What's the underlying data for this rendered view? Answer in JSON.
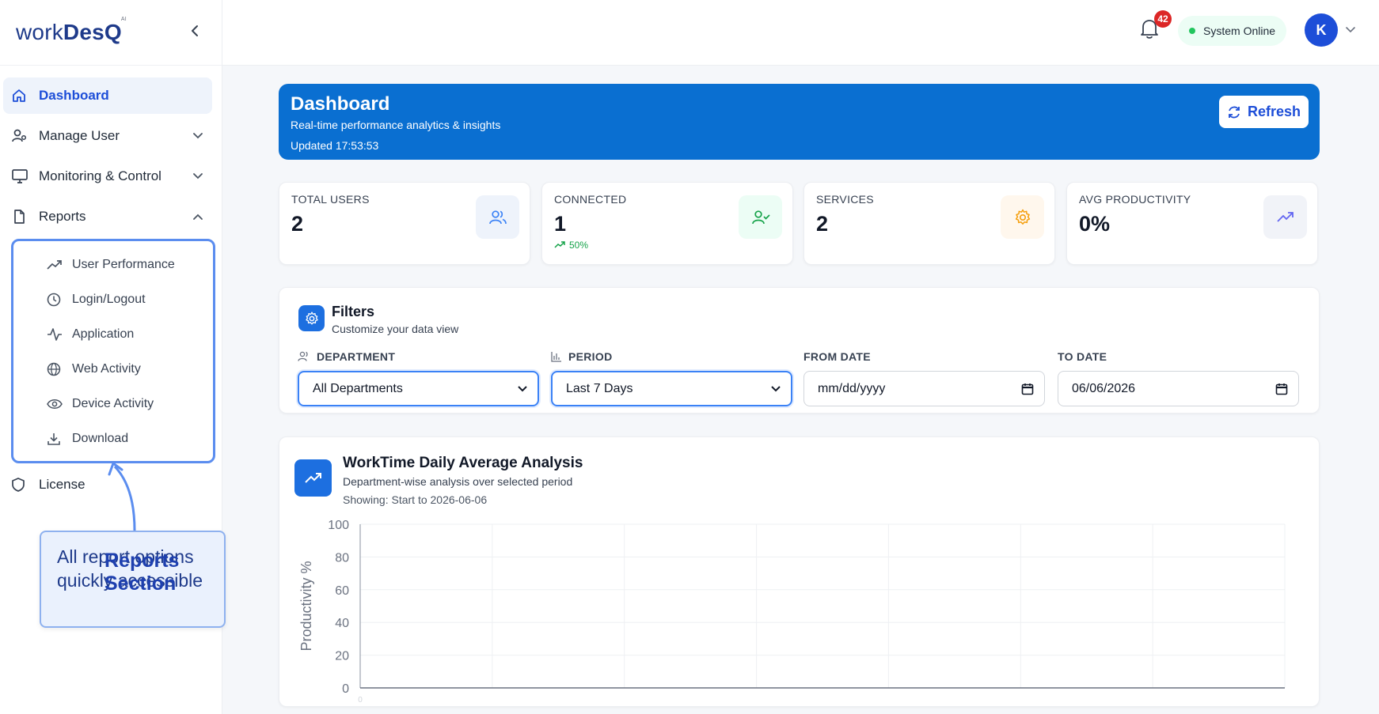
{
  "brand": {
    "part1": "work",
    "part2": "DesQ",
    "mark": "AI"
  },
  "sidebar": {
    "items": [
      {
        "label": "Dashboard",
        "icon": "home-icon"
      },
      {
        "label": "Manage User",
        "icon": "users-icon"
      },
      {
        "label": "Monitoring & Control",
        "icon": "monitor-icon"
      },
      {
        "label": "Reports",
        "icon": "file-icon"
      },
      {
        "label": "License",
        "icon": "shield-icon"
      }
    ],
    "reports_sub": [
      {
        "label": "User Performance",
        "icon": "trending-up-icon"
      },
      {
        "label": "Login/Logout",
        "icon": "clock-icon"
      },
      {
        "label": "Application",
        "icon": "activity-icon"
      },
      {
        "label": "Web Activity",
        "icon": "globe-icon"
      },
      {
        "label": "Device Activity",
        "icon": "eye-icon"
      },
      {
        "label": "Download",
        "icon": "download-icon"
      }
    ]
  },
  "callout": {
    "title": "Reports Section",
    "line1": "All report options",
    "line2": "quickly accessible"
  },
  "topbar": {
    "notifications": "42",
    "status": "System Online",
    "avatar": "K"
  },
  "hero": {
    "title": "Dashboard",
    "subtitle": "Real-time performance analytics & insights",
    "updated": "Updated 17:53:53",
    "refresh": "Refresh"
  },
  "stats": [
    {
      "label": "TOTAL USERS",
      "value": "2",
      "icon": "users-icon"
    },
    {
      "label": "CONNECTED",
      "value": "1",
      "trend": "50%",
      "icon": "user-check-icon"
    },
    {
      "label": "SERVICES",
      "value": "2",
      "icon": "gear-icon"
    },
    {
      "label": "AVG PRODUCTIVITY",
      "value": "0%",
      "icon": "trending-up-icon"
    }
  ],
  "filters": {
    "title": "Filters",
    "subtitle": "Customize your data view",
    "department_label": "DEPARTMENT",
    "department_value": "All Departments",
    "period_label": "PERIOD",
    "period_value": "Last 7 Days",
    "from_label": "FROM DATE",
    "from_value": "mm/dd/yyyy",
    "to_label": "TO DATE",
    "to_value": "06/06/2026"
  },
  "chart_card": {
    "title": "WorkTime Daily Average Analysis",
    "subtitle": "Department-wise analysis over selected period",
    "showing": "Showing: Start to 2026-06-06"
  },
  "chart_data": {
    "type": "line",
    "title": "",
    "ylabel": "Productivity %",
    "xlabel": "",
    "ylim": [
      0,
      100
    ],
    "yticks": [
      0,
      20,
      40,
      60,
      80,
      100
    ],
    "x_tick_label": "0",
    "grid": true,
    "series": []
  },
  "colors": {
    "primary": "#0a6fd1",
    "accent": "#1d4ed8",
    "online": "#22c55e",
    "badge": "#dc2626"
  }
}
